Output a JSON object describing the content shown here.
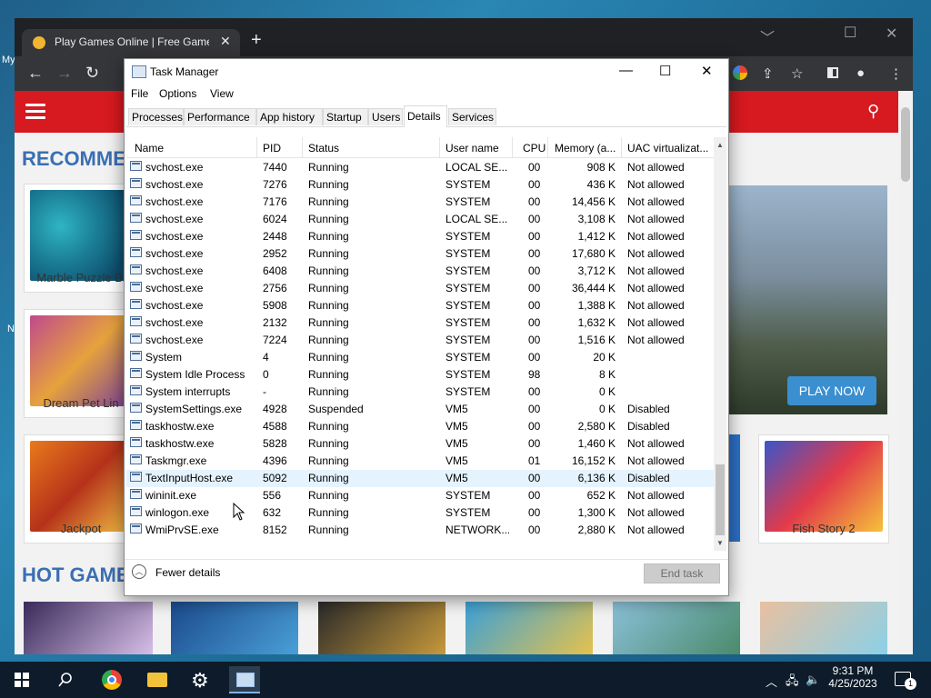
{
  "desktop": {
    "side_label_1": "My",
    "side_label_2": "N"
  },
  "browser": {
    "tab_title": "Play Games Online | Free Games",
    "close_tab": "✕",
    "new_tab": "+",
    "win_min": "﹀",
    "win_restore": "☐",
    "win_close": "✕",
    "back": "←",
    "forward": "→",
    "reload": "↻"
  },
  "website": {
    "section_recommended": "RECOMMEN",
    "section_hot": "HOT GAMES",
    "cards": [
      {
        "caption": "Marble Puzzle Bl"
      },
      {
        "caption": "Dream Pet Lin"
      },
      {
        "caption": "Jackpot"
      },
      {
        "caption": "Fish Story 2"
      }
    ],
    "play_now": "PLAY NOW"
  },
  "taskmanager": {
    "title": "Task Manager",
    "controls": {
      "minimize": "—",
      "maximize": "☐",
      "close": "✕"
    },
    "menu": [
      "File",
      "Options",
      "View"
    ],
    "tabs": [
      "Processes",
      "Performance",
      "App history",
      "Startup",
      "Users",
      "Details",
      "Services"
    ],
    "active_tab": "Details",
    "columns": [
      "Name",
      "PID",
      "Status",
      "User name",
      "CPU",
      "Memory (a...",
      "UAC virtualizat..."
    ],
    "rows": [
      {
        "name": "svchost.exe",
        "pid": "7440",
        "status": "Running",
        "user": "LOCAL SE...",
        "cpu": "00",
        "mem": "908 K",
        "uac": "Not allowed"
      },
      {
        "name": "svchost.exe",
        "pid": "7276",
        "status": "Running",
        "user": "SYSTEM",
        "cpu": "00",
        "mem": "436 K",
        "uac": "Not allowed"
      },
      {
        "name": "svchost.exe",
        "pid": "7176",
        "status": "Running",
        "user": "SYSTEM",
        "cpu": "00",
        "mem": "14,456 K",
        "uac": "Not allowed"
      },
      {
        "name": "svchost.exe",
        "pid": "6024",
        "status": "Running",
        "user": "LOCAL SE...",
        "cpu": "00",
        "mem": "3,108 K",
        "uac": "Not allowed"
      },
      {
        "name": "svchost.exe",
        "pid": "2448",
        "status": "Running",
        "user": "SYSTEM",
        "cpu": "00",
        "mem": "1,412 K",
        "uac": "Not allowed"
      },
      {
        "name": "svchost.exe",
        "pid": "2952",
        "status": "Running",
        "user": "SYSTEM",
        "cpu": "00",
        "mem": "17,680 K",
        "uac": "Not allowed"
      },
      {
        "name": "svchost.exe",
        "pid": "6408",
        "status": "Running",
        "user": "SYSTEM",
        "cpu": "00",
        "mem": "3,712 K",
        "uac": "Not allowed"
      },
      {
        "name": "svchost.exe",
        "pid": "2756",
        "status": "Running",
        "user": "SYSTEM",
        "cpu": "00",
        "mem": "36,444 K",
        "uac": "Not allowed"
      },
      {
        "name": "svchost.exe",
        "pid": "5908",
        "status": "Running",
        "user": "SYSTEM",
        "cpu": "00",
        "mem": "1,388 K",
        "uac": "Not allowed"
      },
      {
        "name": "svchost.exe",
        "pid": "2132",
        "status": "Running",
        "user": "SYSTEM",
        "cpu": "00",
        "mem": "1,632 K",
        "uac": "Not allowed"
      },
      {
        "name": "svchost.exe",
        "pid": "7224",
        "status": "Running",
        "user": "SYSTEM",
        "cpu": "00",
        "mem": "1,516 K",
        "uac": "Not allowed"
      },
      {
        "name": "System",
        "pid": "4",
        "status": "Running",
        "user": "SYSTEM",
        "cpu": "00",
        "mem": "20 K",
        "uac": ""
      },
      {
        "name": "System Idle Process",
        "pid": "0",
        "status": "Running",
        "user": "SYSTEM",
        "cpu": "98",
        "mem": "8 K",
        "uac": ""
      },
      {
        "name": "System interrupts",
        "pid": "-",
        "status": "Running",
        "user": "SYSTEM",
        "cpu": "00",
        "mem": "0 K",
        "uac": ""
      },
      {
        "name": "SystemSettings.exe",
        "pid": "4928",
        "status": "Suspended",
        "user": "VM5",
        "cpu": "00",
        "mem": "0 K",
        "uac": "Disabled"
      },
      {
        "name": "taskhostw.exe",
        "pid": "4588",
        "status": "Running",
        "user": "VM5",
        "cpu": "00",
        "mem": "2,580 K",
        "uac": "Disabled"
      },
      {
        "name": "taskhostw.exe",
        "pid": "5828",
        "status": "Running",
        "user": "VM5",
        "cpu": "00",
        "mem": "1,460 K",
        "uac": "Not allowed"
      },
      {
        "name": "Taskmgr.exe",
        "pid": "4396",
        "status": "Running",
        "user": "VM5",
        "cpu": "01",
        "mem": "16,152 K",
        "uac": "Not allowed"
      },
      {
        "name": "TextInputHost.exe",
        "pid": "5092",
        "status": "Running",
        "user": "VM5",
        "cpu": "00",
        "mem": "6,136 K",
        "uac": "Disabled",
        "selected": true
      },
      {
        "name": "wininit.exe",
        "pid": "556",
        "status": "Running",
        "user": "SYSTEM",
        "cpu": "00",
        "mem": "652 K",
        "uac": "Not allowed"
      },
      {
        "name": "winlogon.exe",
        "pid": "632",
        "status": "Running",
        "user": "SYSTEM",
        "cpu": "00",
        "mem": "1,300 K",
        "uac": "Not allowed"
      },
      {
        "name": "WmiPrvSE.exe",
        "pid": "8152",
        "status": "Running",
        "user": "NETWORK...",
        "cpu": "00",
        "mem": "2,880 K",
        "uac": "Not allowed"
      }
    ],
    "fewer_details": "Fewer details",
    "end_task": "End task"
  },
  "taskbar": {
    "time": "9:31 PM",
    "date": "4/25/2023",
    "notifications": "1"
  }
}
